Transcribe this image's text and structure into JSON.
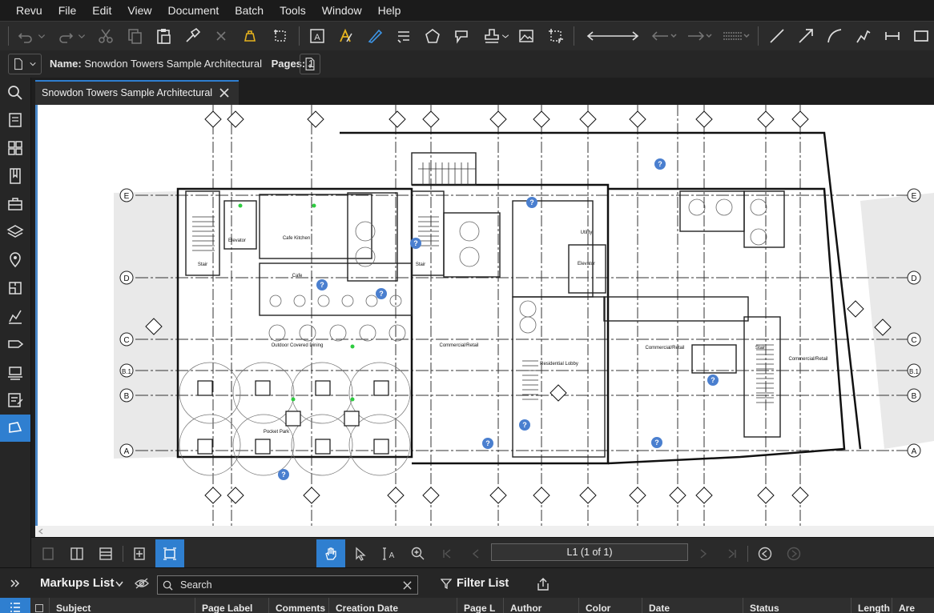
{
  "menu": [
    "Revu",
    "File",
    "Edit",
    "View",
    "Document",
    "Batch",
    "Tools",
    "Window",
    "Help"
  ],
  "doc_header": {
    "name_label": "Name:",
    "name_value": "Snowdon Towers Sample Architectural",
    "pages_label": "Pages:",
    "pages_value": "1"
  },
  "tab": {
    "title": "Snowdon Towers Sample Architectural"
  },
  "drawing": {
    "grid_rows": [
      "E",
      "D",
      "C",
      "B.1",
      "B",
      "A"
    ],
    "rooms": [
      "Stair",
      "Elevator",
      "Cafe Kitchen",
      "Cafe",
      "Outdoor Covered Dining",
      "Pocket Park",
      "Commercial/Retail",
      "Residential Lobby",
      "Utility",
      "Elevator",
      "Commercial/Retail",
      "Commercial/Retail",
      "Stair",
      "Stair"
    ]
  },
  "nav": {
    "page_indicator": "L1 (1 of 1)"
  },
  "markups": {
    "title": "Markups List",
    "search_placeholder": "Search",
    "filter_label": "Filter List",
    "columns": [
      "Subject",
      "Page Label",
      "Comments",
      "Creation Date",
      "Page L",
      "Author",
      "Color",
      "Date",
      "Status",
      "Length",
      "Are"
    ]
  },
  "colors": {
    "accent": "#2f7fd0",
    "toolbar_bg": "#2b2b2b",
    "canvas_bg": "#ffffff"
  },
  "icons": {
    "toolbar": [
      "undo-icon",
      "redo-icon",
      "cut-icon",
      "copy-icon",
      "paste-icon",
      "format-painter-icon",
      "delete-icon",
      "bell-icon",
      "crop-icon",
      "text-box-icon",
      "highlight-icon",
      "pen-icon",
      "typewriter-icon",
      "polygon-icon",
      "callout-icon",
      "stamp-icon",
      "image-icon",
      "snapshot-icon",
      "dimension-line-icon",
      "start-arrow-icon",
      "end-arrow-icon",
      "line-style-icon",
      "line-icon",
      "arrow-icon",
      "arc-icon",
      "polyline-icon",
      "dimension-icon",
      "rectangle-icon"
    ],
    "sidebar": [
      "search-icon",
      "thumbnails-icon",
      "layout-icon",
      "bookmarks-icon",
      "toolchest-icon",
      "layers-icon",
      "places-icon",
      "spaces-icon",
      "signatures-icon",
      "tags-icon",
      "stamp-icon",
      "forms-icon",
      "measurements-icon"
    ]
  }
}
